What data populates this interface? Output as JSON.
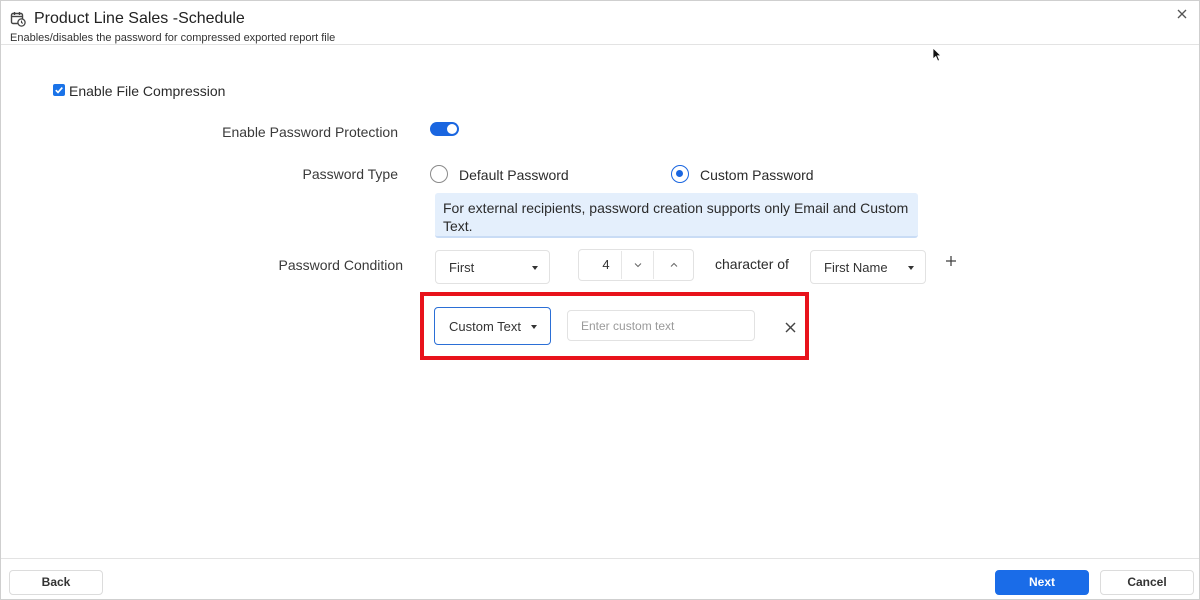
{
  "header": {
    "title": "Product Line Sales -Schedule",
    "subtitle": "Enables/disables the password for compressed exported report file",
    "icon": "calendar-clock-icon",
    "close_icon": "close-icon"
  },
  "compression": {
    "label": "Enable File Compression",
    "checked": true
  },
  "password_protection": {
    "label": "Enable Password Protection",
    "enabled": true
  },
  "password_type": {
    "label": "Password Type",
    "options": [
      "Default Password",
      "Custom Password"
    ],
    "selected": "Custom Password"
  },
  "info_text": "For external recipients, password creation supports only Email and Custom Text.",
  "password_condition": {
    "label": "Password Condition",
    "position_value": "First",
    "count": "4",
    "connector": "character of",
    "field_value": "First Name",
    "add_icon": "plus-icon"
  },
  "custom_row": {
    "type_value": "Custom Text",
    "input_value": "",
    "input_placeholder": "Enter custom text",
    "remove_icon": "close-icon"
  },
  "footer": {
    "back_label": "Back",
    "next_label": "Next",
    "cancel_label": "Cancel"
  },
  "colors": {
    "accent": "#1a6ce8",
    "highlight_border": "#e8121b",
    "info_background": "#e4effc"
  }
}
